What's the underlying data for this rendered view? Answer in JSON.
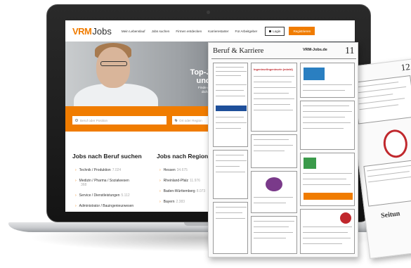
{
  "site": {
    "logo": {
      "part1": "VRM",
      "part2": "Jobs"
    },
    "nav": [
      "Mein Lebenslauf",
      "Jobs suchen",
      "Firmen entdecken",
      "Karrierestarter",
      "Für Arbeitgeber"
    ],
    "login_label": "Login",
    "register_label": "Registrieren",
    "hero": {
      "title_line1": "Top-Jobs in Rhein",
      "title_line2": "und Mittelhess",
      "sub_line1": "Finde den Job, der zu dir passt! O",
      "sub_line2": "dich von Top-Arbeitgebern fin"
    },
    "search": {
      "what_placeholder": "Beruf oder Position",
      "where_placeholder": "Ort oder Region"
    },
    "columns": {
      "by_profession": {
        "title": "Jobs nach Beruf suchen",
        "items": [
          {
            "label": "Technik / Produktion",
            "count": "7.024"
          },
          {
            "label": "Medizin / Pharma / Sozialwesen",
            "count": "368"
          },
          {
            "label": "Service / Dienstleistungen",
            "count": "5.112"
          },
          {
            "label": "Administrator / Bauingenieurwesen",
            "count": ""
          }
        ]
      },
      "by_region": {
        "title": "Jobs nach Region suche",
        "items": [
          {
            "label": "Hessen",
            "count": "34.675"
          },
          {
            "label": "Rheinland-Pfalz",
            "count": "11.976"
          },
          {
            "label": "Baden-Württemberg",
            "count": "8.073"
          },
          {
            "label": "Bayern",
            "count": "2.383"
          }
        ]
      }
    }
  },
  "newspaper_front": {
    "section_title": "Beruf & Karriere",
    "logo": "VRM-Jobs.de",
    "page_number": "11",
    "headline_ad": "Ingenieur/Ingenieurin (m/w/d)"
  },
  "newspaper_back": {
    "page_number": "12",
    "fragment": "Seitun"
  },
  "colors": {
    "brand_orange": "#f07c00",
    "laptop_frame": "#1c1c1c",
    "ad_red": "#c0282d",
    "ad_blue": "#1e4f9a"
  }
}
